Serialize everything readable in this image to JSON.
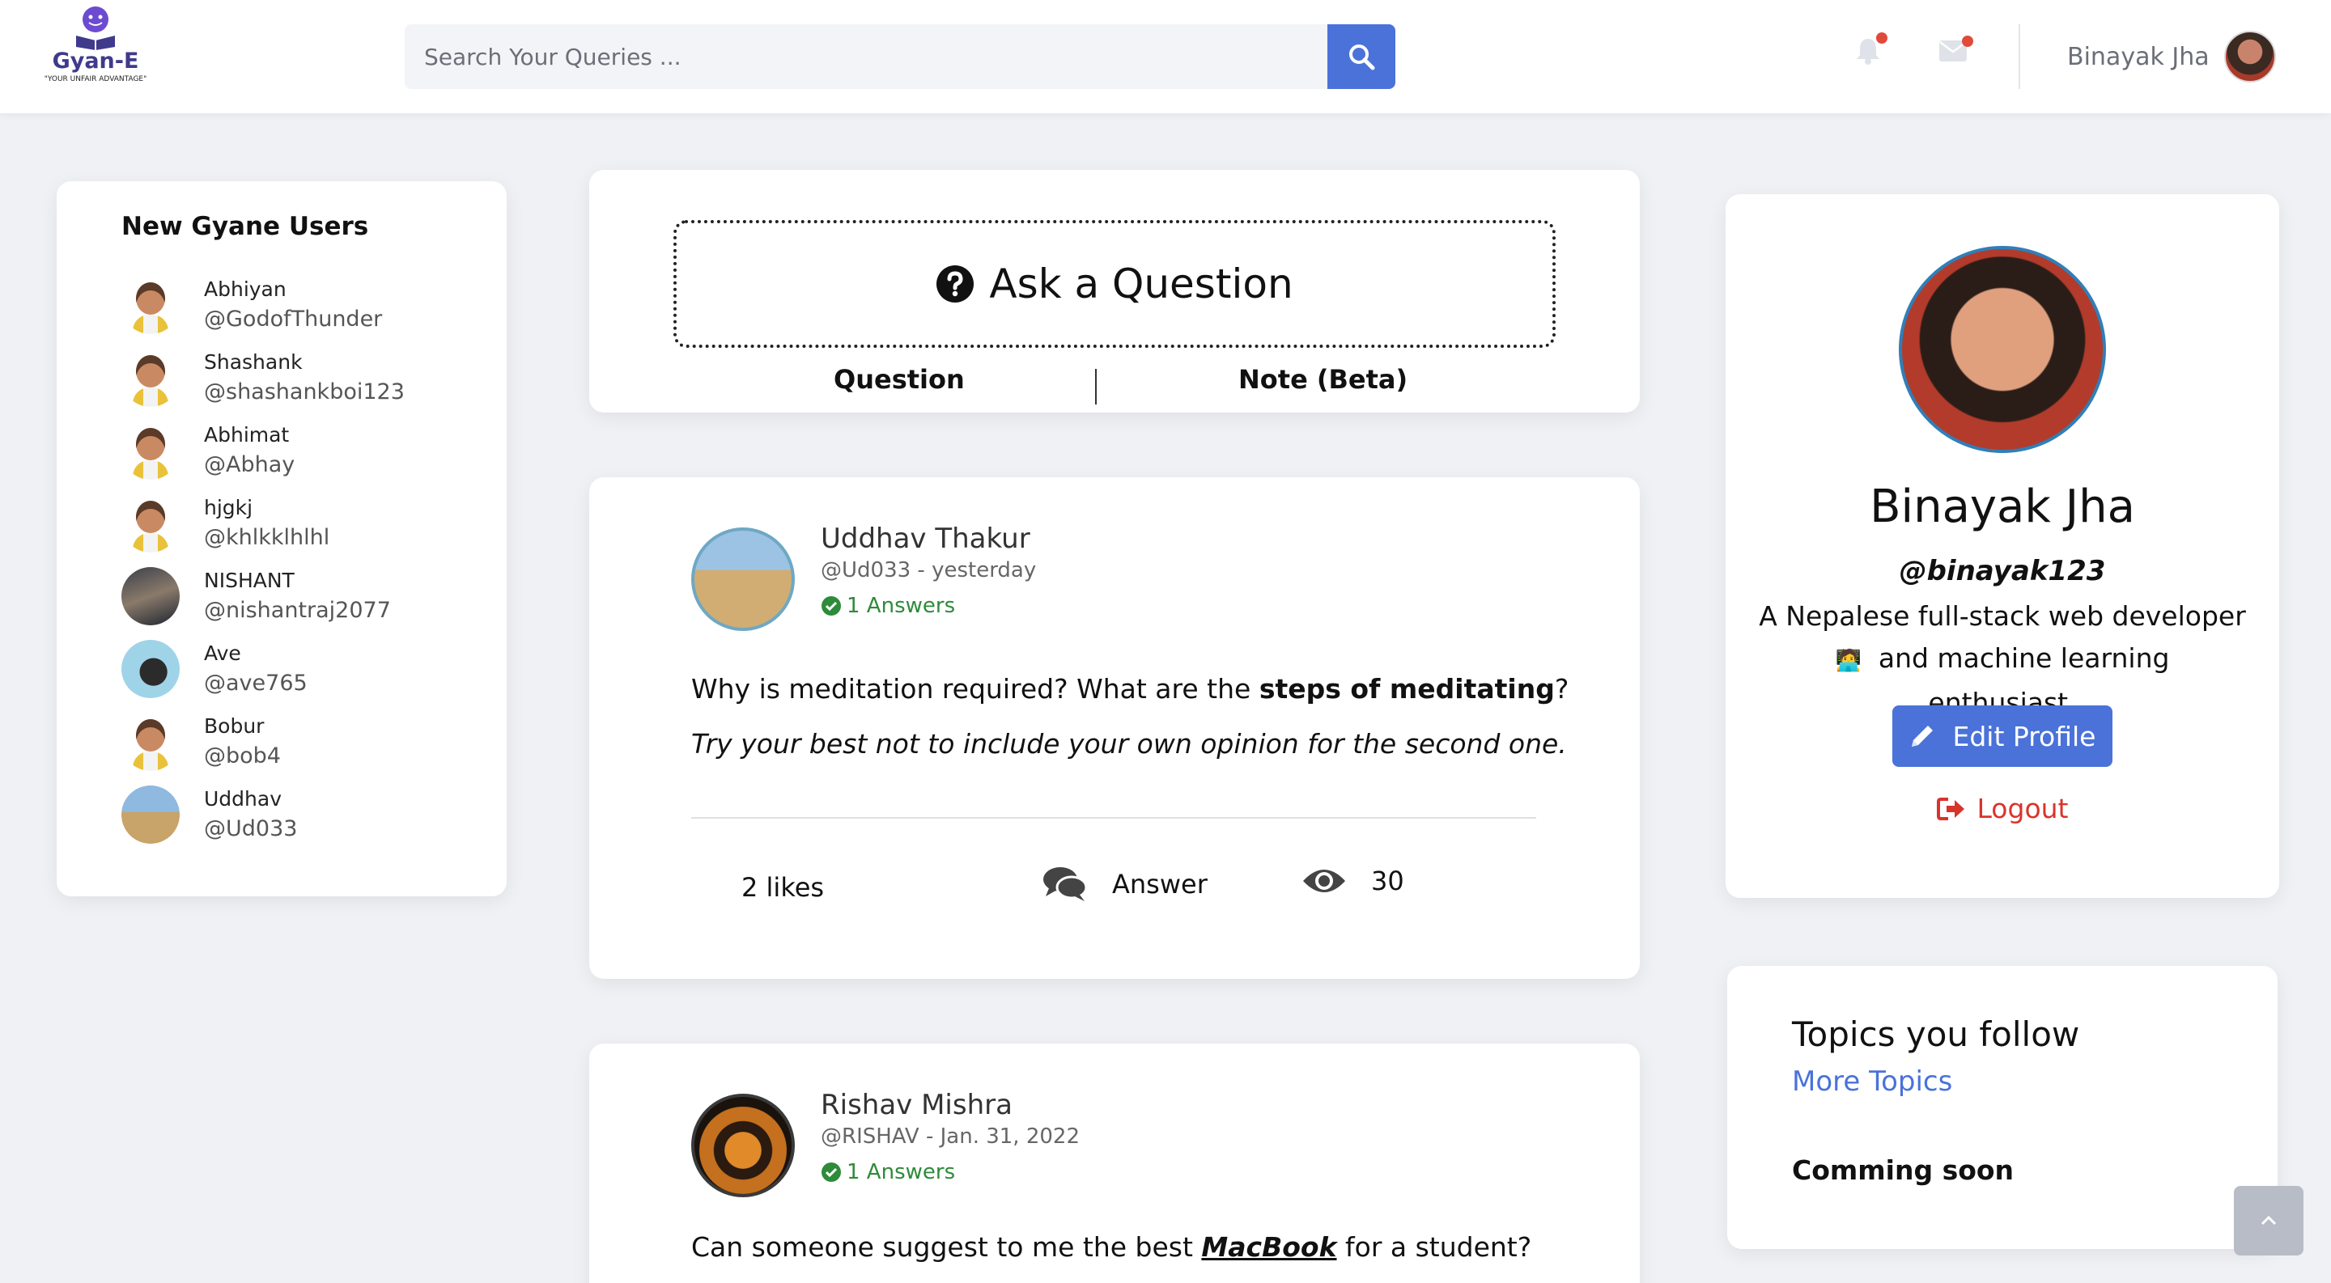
{
  "brand": {
    "name": "Gyan-E",
    "tagline": "\"YOUR UNFAIR ADVANTAGE\"",
    "accent": "#4a72d9"
  },
  "search": {
    "placeholder": "Search Your Queries ...",
    "value": "",
    "icon": "search-icon"
  },
  "nav": {
    "notifications_icon": "bell-icon",
    "messages_icon": "envelope-icon",
    "user_name": "Binayak Jha"
  },
  "new_users": {
    "title": "New Gyane Users",
    "items": [
      {
        "name": "Abhiyan",
        "handle": "@GodofThunder"
      },
      {
        "name": "Shashank",
        "handle": "@shashankboi123"
      },
      {
        "name": "Abhimat",
        "handle": "@Abhay"
      },
      {
        "name": "hjgkj",
        "handle": "@khlkklhlhl"
      },
      {
        "name": "NISHANT",
        "handle": "@nishantraj2077"
      },
      {
        "name": "Ave",
        "handle": "@ave765"
      },
      {
        "name": "Bobur",
        "handle": "@bob4"
      },
      {
        "name": "Uddhav",
        "handle": "@Ud033"
      }
    ]
  },
  "ask": {
    "label": "Ask a Question",
    "tab_question": "Question",
    "tab_note": "Note (Beta)"
  },
  "questions": [
    {
      "author": "Uddhav Thakur",
      "meta": "@Ud033 - yesterday",
      "answers": "1 Answers",
      "text_before": "Why is meditation required? What are the ",
      "text_bold": "steps of meditating",
      "text_after": "?",
      "subtext": "Try your best not to include your own opinion for the second one.",
      "likes": "2 likes",
      "answer_label": "Answer",
      "views": "30"
    },
    {
      "author": "Rishav Mishra",
      "meta": "@RISHAV - Jan. 31, 2022",
      "answers": "1 Answers",
      "text_before": "Can someone suggest to me the best ",
      "text_bold": "MacBook",
      "text_after": " for a student?"
    }
  ],
  "profile": {
    "name": "Binayak Jha",
    "handle": "@binayak123",
    "bio_line1": "A Nepalese full-stack web developer",
    "bio_line2": "and machine learning enthusiast.",
    "edit_label": "Edit Profile",
    "logout_label": "Logout",
    "logout_color": "#d9342b"
  },
  "topics": {
    "title": "Topics you follow",
    "more": "More Topics",
    "status": "Comming soon"
  }
}
